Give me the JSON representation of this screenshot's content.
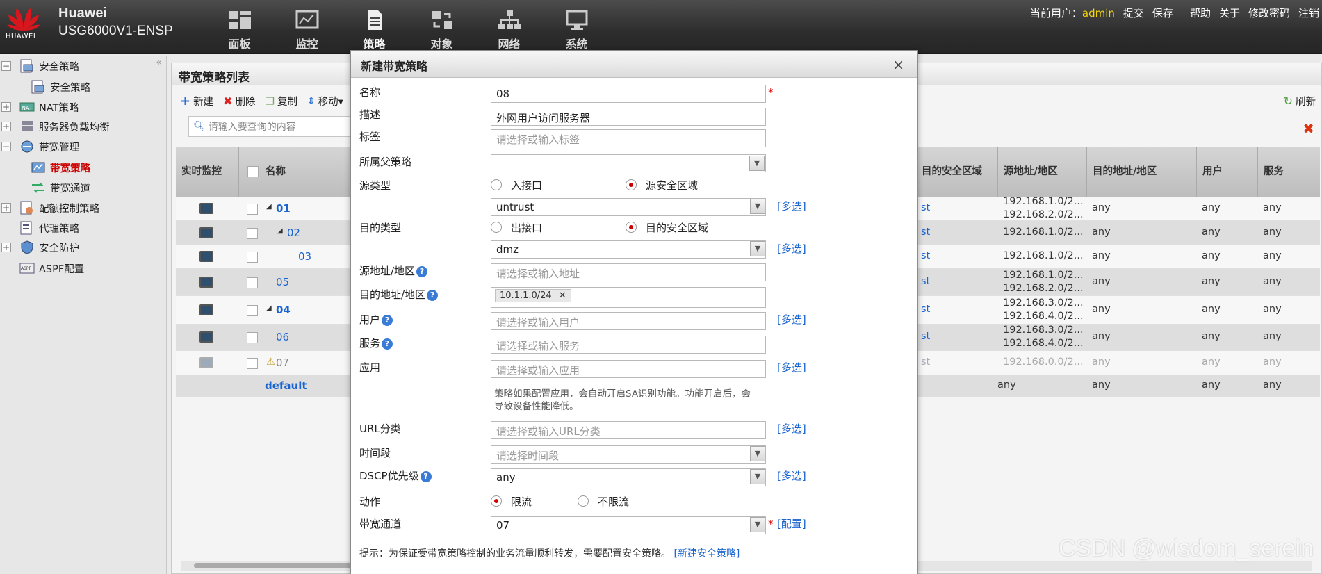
{
  "header": {
    "logo_text": "HUAWEI",
    "brand": "Huawei",
    "model": "USG6000V1-ENSP",
    "nav": [
      {
        "label": "面板",
        "icon": "dashboard-icon"
      },
      {
        "label": "监控",
        "icon": "monitor-icon"
      },
      {
        "label": "策略",
        "icon": "policy-icon"
      },
      {
        "label": "对象",
        "icon": "object-icon"
      },
      {
        "label": "网络",
        "icon": "network-icon"
      },
      {
        "label": "系统",
        "icon": "system-icon"
      }
    ],
    "active_nav": "策略",
    "current_user_label": "当前用户：",
    "current_user": "admin",
    "actions": [
      "提交",
      "保存",
      "帮助",
      "关于",
      "修改密码",
      "注销"
    ]
  },
  "sidebar": {
    "items": [
      {
        "label": "安全策略",
        "level": 0,
        "expander": "−"
      },
      {
        "label": "安全策略",
        "level": 1
      },
      {
        "label": "NAT策略",
        "level": 0,
        "expander": "+"
      },
      {
        "label": "服务器负载均衡",
        "level": 0,
        "expander": "+"
      },
      {
        "label": "带宽管理",
        "level": 0,
        "expander": "−"
      },
      {
        "label": "带宽策略",
        "level": 1,
        "selected": true
      },
      {
        "label": "带宽通道",
        "level": 1
      },
      {
        "label": "配额控制策略",
        "level": 0,
        "expander": "+"
      },
      {
        "label": "代理策略",
        "level": 0
      },
      {
        "label": "安全防护",
        "level": 0,
        "expander": "+"
      },
      {
        "label": "ASPF配置",
        "level": 0
      }
    ]
  },
  "panel": {
    "title": "带宽策略列表",
    "toolbar": {
      "new": "新建",
      "delete": "删除",
      "copy": "复制",
      "move": "移动▾",
      "refresh": "刷新"
    },
    "search_placeholder": "请输入要查询的内容"
  },
  "table": {
    "headers": {
      "monitor": "实时监控",
      "name": "名称",
      "dst_zone": "目的安全区域",
      "src_addr": "源地址/地区",
      "dst_addr": "目的地址/地区",
      "user": "用户",
      "service": "服务"
    },
    "rows": [
      {
        "name": "01",
        "tree": "◢",
        "zone": "st",
        "src": [
          "192.168.1.0/2...",
          "192.168.2.0/2..."
        ],
        "dst": "any",
        "user": "any",
        "service": "any"
      },
      {
        "name": "02",
        "tree": "◢",
        "zone": "st",
        "src": [
          "192.168.1.0/2..."
        ],
        "dst": "any",
        "user": "any",
        "service": "any"
      },
      {
        "name": "03",
        "tree": "",
        "zone": "st",
        "src": [
          "192.168.1.0/2..."
        ],
        "dst": "any",
        "user": "any",
        "service": "any"
      },
      {
        "name": "05",
        "tree": "",
        "zone": "st",
        "src": [
          "192.168.1.0/2...",
          "192.168.2.0/2..."
        ],
        "dst": "any",
        "user": "any",
        "service": "any"
      },
      {
        "name": "04",
        "tree": "◢",
        "zone": "st",
        "src": [
          "192.168.3.0/2...",
          "192.168.4.0/2..."
        ],
        "dst": "any",
        "user": "any",
        "service": "any"
      },
      {
        "name": "06",
        "tree": "",
        "zone": "st",
        "src": [
          "192.168.3.0/2...",
          "192.168.4.0/2..."
        ],
        "dst": "any",
        "user": "any",
        "service": "any"
      },
      {
        "name": "07",
        "tree": "",
        "zone": "st",
        "src": [
          "192.168.0.0/2..."
        ],
        "dst": "any",
        "user": "any",
        "service": "any"
      },
      {
        "name": "default",
        "tree": "",
        "zone": "",
        "src": [
          "any"
        ],
        "dst": "any",
        "user": "any",
        "service": "any"
      }
    ]
  },
  "dialog": {
    "title": "新建带宽策略",
    "close": "×",
    "name_label": "名称",
    "name_value": "08",
    "desc_label": "描述",
    "desc_value": "外网用户访问服务器",
    "tag_label": "标签",
    "tag_placeholder": "请选择或输入标签",
    "parent_label": "所属父策略",
    "src_type_label": "源类型",
    "src_type_opt1": "入接口",
    "src_type_opt2": "源安全区域",
    "src_zone_value": "untrust",
    "dst_type_label": "目的类型",
    "dst_type_opt1": "出接口",
    "dst_type_opt2": "目的安全区域",
    "dst_zone_value": "dmz",
    "src_addr_label": "源地址/地区",
    "src_addr_placeholder": "请选择或输入地址",
    "dst_addr_label": "目的地址/地区",
    "dst_addr_tag": "10.1.1.0/24",
    "user_label": "用户",
    "user_placeholder": "请选择或输入用户",
    "service_label": "服务",
    "service_placeholder": "请选择或输入服务",
    "app_label": "应用",
    "app_placeholder": "请选择或输入应用",
    "app_hint": "策略如果配置应用，会自动开启SA识别功能。功能开启后，会导致设备性能降低。",
    "url_label": "URL分类",
    "url_placeholder": "请选择或输入URL分类",
    "time_label": "时间段",
    "time_placeholder": "请选择时间段",
    "dscp_label": "DSCP优先级",
    "dscp_value": "any",
    "action_label": "动作",
    "action_opt1": "限流",
    "action_opt2": "不限流",
    "channel_label": "带宽通道",
    "channel_value": "07",
    "multi": "[多选]",
    "config": "[配置]",
    "footer_text": "提示：为保证受带宽策略控制的业务流量顺利转发，需要配置安全策略。",
    "footer_link": "[新建安全策略]"
  },
  "watermark": "CSDN @wisdom_serein",
  "colors": {
    "accent_red": "#cc0000",
    "link_blue": "#1a64d0",
    "user_yellow": "#f5d60a"
  }
}
